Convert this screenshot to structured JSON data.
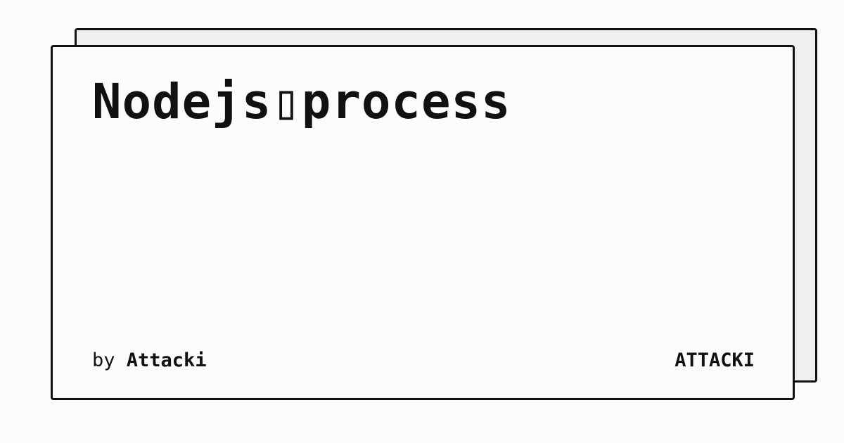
{
  "card": {
    "title": "Nodejs▯process",
    "byline_prefix": "by",
    "author": "Attacki",
    "site_name": "ATTACKI"
  },
  "colors": {
    "background": "#fdfcfa",
    "back_card": "#efefef",
    "border": "#111111",
    "text": "#111111"
  }
}
